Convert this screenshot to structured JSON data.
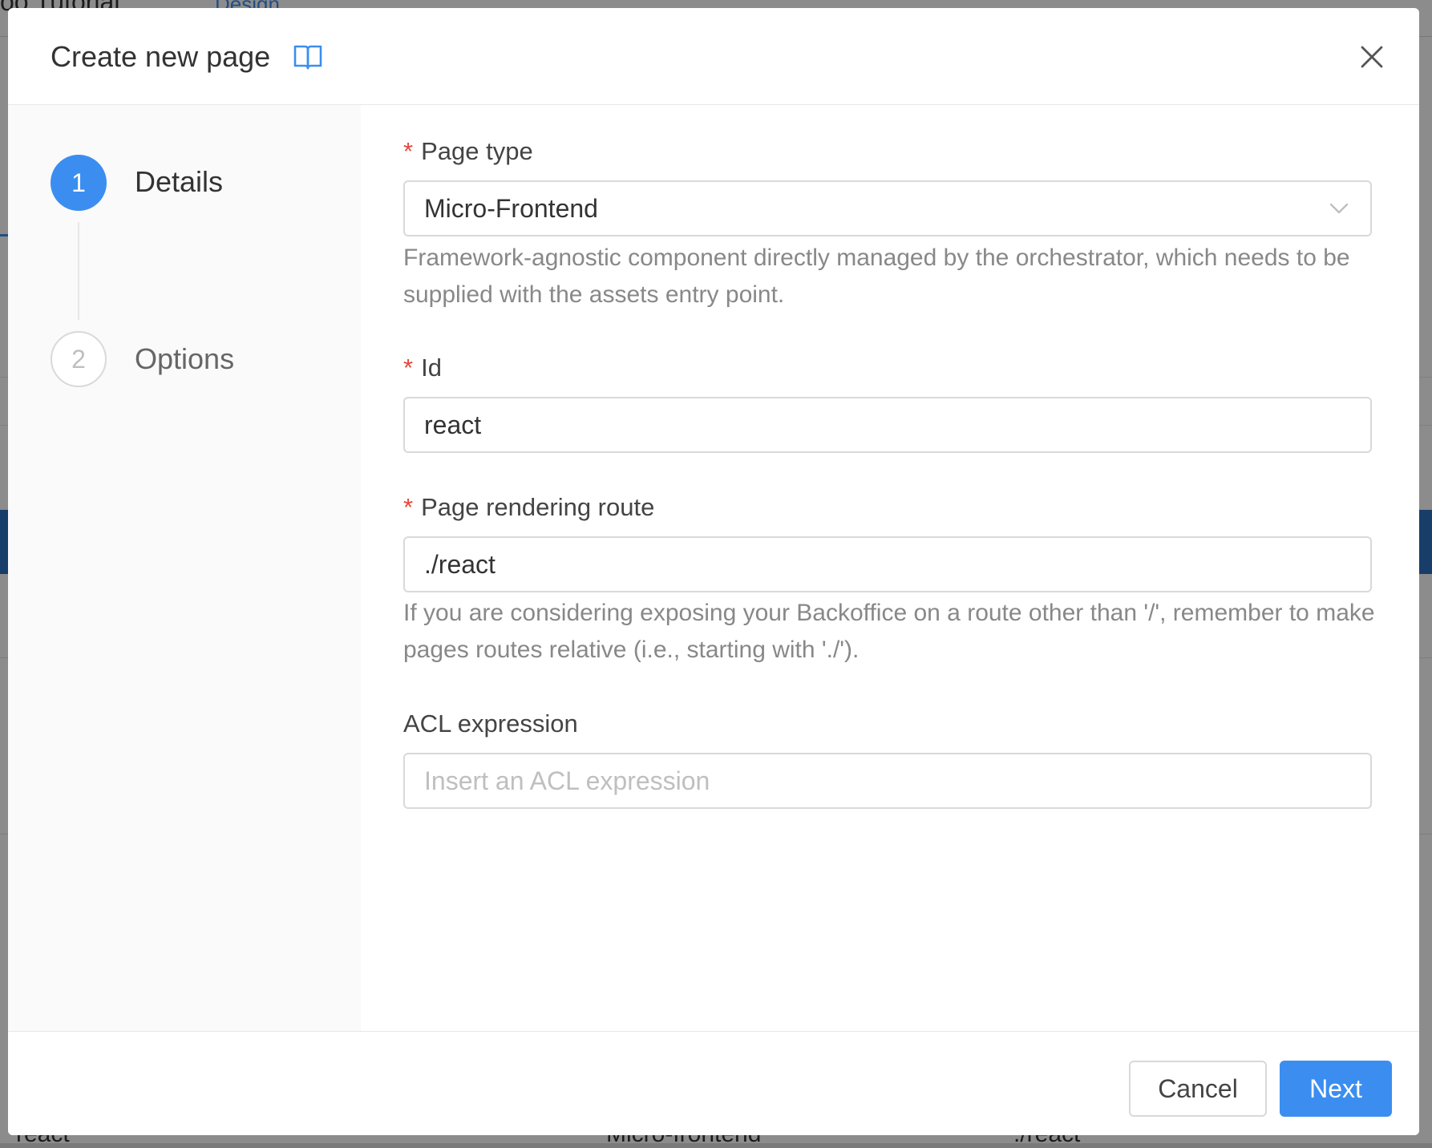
{
  "background": {
    "title": "oo Tutorial",
    "active_tab": "Design",
    "row_cells": [
      "react",
      "Micro-frontend",
      "./react"
    ]
  },
  "modal": {
    "title": "Create new page",
    "icons": {
      "docs": "book-icon",
      "close": "close-icon"
    }
  },
  "steps": [
    {
      "number": "1",
      "label": "Details",
      "state": "active"
    },
    {
      "number": "2",
      "label": "Options",
      "state": "inactive"
    }
  ],
  "form": {
    "page_type": {
      "label": "Page type",
      "required_mark": "*",
      "value": "Micro-Frontend",
      "help": "Framework-agnostic component directly managed by the orchestrator, which needs to be supplied with the assets entry point."
    },
    "id": {
      "label": "Id",
      "required_mark": "*",
      "value": "react"
    },
    "route": {
      "label": "Page rendering route",
      "required_mark": "*",
      "value": "./react",
      "help": "If you are considering exposing your Backoffice on a route other than '/', remember to make pages routes relative (i.e., starting with './')."
    },
    "acl": {
      "label": "ACL expression",
      "placeholder": "Insert an ACL expression"
    }
  },
  "footer": {
    "cancel_label": "Cancel",
    "next_label": "Next"
  },
  "colors": {
    "primary": "#3b8ef0",
    "required": "#e8443a"
  }
}
